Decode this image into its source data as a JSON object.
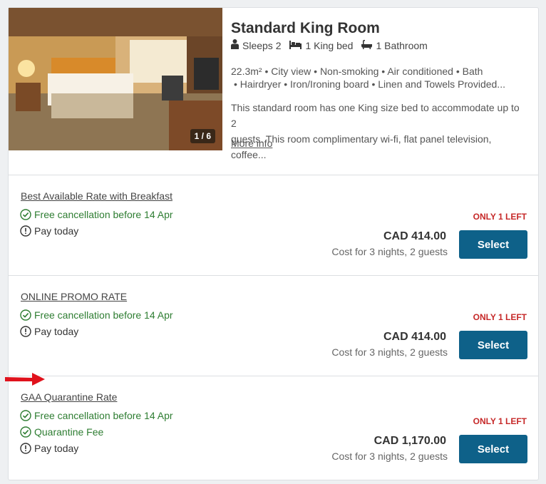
{
  "room": {
    "title": "Standard King Room",
    "sleeps": "Sleeps 2",
    "bed": "1 King bed",
    "bathroom": "1 Bathroom",
    "image_counter": "1 / 6",
    "amenities_line1": "22.3m² • City view • Non-smoking • Air conditioned • Bath",
    "amenities_line2": "• Hairdryer • Iron/Ironing board • Linen and Towels Provided...",
    "description_line1": "This standard room has one King size bed to accommodate up to 2",
    "description_line2": "guests. This room complimentary wi-fi, flat panel television, coffee...",
    "more_info": "More info"
  },
  "rates": [
    {
      "name": "Best Available Rate with Breakfast",
      "features": [
        {
          "text": "Free cancellation before 14 Apr",
          "kind": "check"
        },
        {
          "text": "Pay today",
          "kind": "info"
        }
      ],
      "availability": "ONLY 1 LEFT",
      "price": "CAD 414.00",
      "cost_note": "Cost for 3 nights, 2 guests",
      "button": "Select"
    },
    {
      "name": "ONLINE PROMO RATE",
      "features": [
        {
          "text": "Free cancellation before 14 Apr",
          "kind": "check"
        },
        {
          "text": "Pay today",
          "kind": "info"
        }
      ],
      "availability": "ONLY 1 LEFT",
      "price": "CAD 414.00",
      "cost_note": "Cost for 3 nights, 2 guests",
      "button": "Select"
    },
    {
      "name": "GAA Quarantine Rate",
      "features": [
        {
          "text": "Free cancellation before 14 Apr",
          "kind": "check"
        },
        {
          "text": "Quarantine Fee",
          "kind": "check"
        },
        {
          "text": "Pay today",
          "kind": "info"
        }
      ],
      "availability": "ONLY 1 LEFT",
      "price": "CAD 1,170.00",
      "cost_note": "Cost for 3 nights, 2 guests",
      "button": "Select"
    }
  ],
  "colors": {
    "accent_button": "#0e6189",
    "success_green": "#2e7d32",
    "alert_red": "#c62828",
    "annotation_arrow": "#e0121c"
  }
}
